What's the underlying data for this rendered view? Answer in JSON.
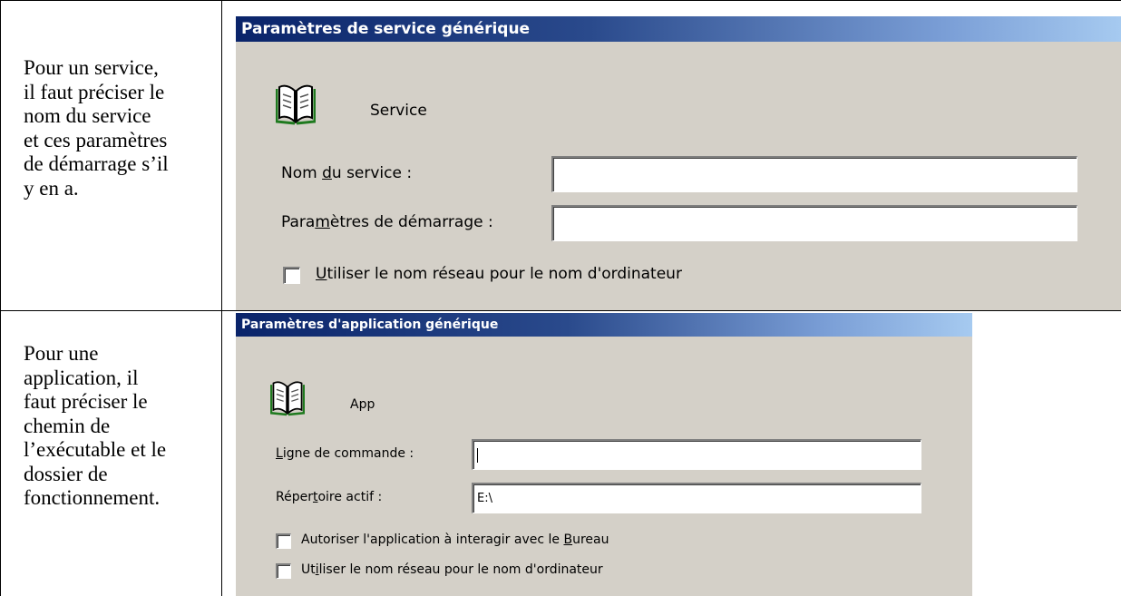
{
  "row1": {
    "description": [
      "Pour un service,",
      "il faut préciser le",
      "nom du service",
      "et ces paramètres",
      "de démarrage s’il",
      "y en a."
    ],
    "dialog": {
      "title": "Paramètres de service générique",
      "heading": "Service",
      "fields": [
        {
          "label_pre": "Nom ",
          "label_u": "d",
          "label_post": "u service :",
          "value": ""
        },
        {
          "label_pre": "Para",
          "label_u": "m",
          "label_post": "ètres de démarrage :",
          "value": ""
        }
      ],
      "checkboxes": [
        {
          "label_pre": "",
          "label_u": "U",
          "label_post": "tiliser le nom réseau pour le nom d'ordinateur",
          "checked": false
        }
      ]
    }
  },
  "row2": {
    "description": [
      "Pour une",
      "application, il",
      "faut préciser le",
      "chemin de",
      "l’exécutable et le",
      "dossier de",
      "fonctionnement."
    ],
    "dialog": {
      "title": "Paramètres d'application générique",
      "heading": "App",
      "fields": [
        {
          "label_pre": "",
          "label_u": "L",
          "label_post": "igne de commande :",
          "value": ""
        },
        {
          "label_pre": "Réper",
          "label_u": "t",
          "label_post": "oire actif :",
          "value": "E:\\"
        }
      ],
      "checkboxes": [
        {
          "label_pre": "Autoriser l'application à interagir avec le ",
          "label_u": "B",
          "label_post": "ureau",
          "checked": false
        },
        {
          "label_pre": "Ut",
          "label_u": "i",
          "label_post": "liser le nom réseau pour le nom d'ordinateur",
          "checked": false
        }
      ]
    }
  },
  "icons": {
    "dialog_icon": "open-book-icon"
  },
  "colors": {
    "dialog_bg": "#d4d0c8",
    "titlebar_start": "#0a246a",
    "titlebar_end": "#a6caf0"
  }
}
